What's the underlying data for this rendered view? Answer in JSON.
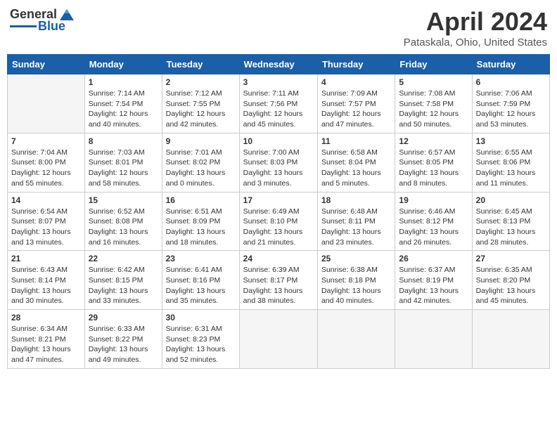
{
  "logo": {
    "general": "General",
    "blue": "Blue"
  },
  "title": "April 2024",
  "location": "Pataskala, Ohio, United States",
  "days_of_week": [
    "Sunday",
    "Monday",
    "Tuesday",
    "Wednesday",
    "Thursday",
    "Friday",
    "Saturday"
  ],
  "weeks": [
    [
      {
        "day": "",
        "info": ""
      },
      {
        "day": "1",
        "info": "Sunrise: 7:14 AM\nSunset: 7:54 PM\nDaylight: 12 hours\nand 40 minutes."
      },
      {
        "day": "2",
        "info": "Sunrise: 7:12 AM\nSunset: 7:55 PM\nDaylight: 12 hours\nand 42 minutes."
      },
      {
        "day": "3",
        "info": "Sunrise: 7:11 AM\nSunset: 7:56 PM\nDaylight: 12 hours\nand 45 minutes."
      },
      {
        "day": "4",
        "info": "Sunrise: 7:09 AM\nSunset: 7:57 PM\nDaylight: 12 hours\nand 47 minutes."
      },
      {
        "day": "5",
        "info": "Sunrise: 7:08 AM\nSunset: 7:58 PM\nDaylight: 12 hours\nand 50 minutes."
      },
      {
        "day": "6",
        "info": "Sunrise: 7:06 AM\nSunset: 7:59 PM\nDaylight: 12 hours\nand 53 minutes."
      }
    ],
    [
      {
        "day": "7",
        "info": "Sunrise: 7:04 AM\nSunset: 8:00 PM\nDaylight: 12 hours\nand 55 minutes."
      },
      {
        "day": "8",
        "info": "Sunrise: 7:03 AM\nSunset: 8:01 PM\nDaylight: 12 hours\nand 58 minutes."
      },
      {
        "day": "9",
        "info": "Sunrise: 7:01 AM\nSunset: 8:02 PM\nDaylight: 13 hours\nand 0 minutes."
      },
      {
        "day": "10",
        "info": "Sunrise: 7:00 AM\nSunset: 8:03 PM\nDaylight: 13 hours\nand 3 minutes."
      },
      {
        "day": "11",
        "info": "Sunrise: 6:58 AM\nSunset: 8:04 PM\nDaylight: 13 hours\nand 5 minutes."
      },
      {
        "day": "12",
        "info": "Sunrise: 6:57 AM\nSunset: 8:05 PM\nDaylight: 13 hours\nand 8 minutes."
      },
      {
        "day": "13",
        "info": "Sunrise: 6:55 AM\nSunset: 8:06 PM\nDaylight: 13 hours\nand 11 minutes."
      }
    ],
    [
      {
        "day": "14",
        "info": "Sunrise: 6:54 AM\nSunset: 8:07 PM\nDaylight: 13 hours\nand 13 minutes."
      },
      {
        "day": "15",
        "info": "Sunrise: 6:52 AM\nSunset: 8:08 PM\nDaylight: 13 hours\nand 16 minutes."
      },
      {
        "day": "16",
        "info": "Sunrise: 6:51 AM\nSunset: 8:09 PM\nDaylight: 13 hours\nand 18 minutes."
      },
      {
        "day": "17",
        "info": "Sunrise: 6:49 AM\nSunset: 8:10 PM\nDaylight: 13 hours\nand 21 minutes."
      },
      {
        "day": "18",
        "info": "Sunrise: 6:48 AM\nSunset: 8:11 PM\nDaylight: 13 hours\nand 23 minutes."
      },
      {
        "day": "19",
        "info": "Sunrise: 6:46 AM\nSunset: 8:12 PM\nDaylight: 13 hours\nand 26 minutes."
      },
      {
        "day": "20",
        "info": "Sunrise: 6:45 AM\nSunset: 8:13 PM\nDaylight: 13 hours\nand 28 minutes."
      }
    ],
    [
      {
        "day": "21",
        "info": "Sunrise: 6:43 AM\nSunset: 8:14 PM\nDaylight: 13 hours\nand 30 minutes."
      },
      {
        "day": "22",
        "info": "Sunrise: 6:42 AM\nSunset: 8:15 PM\nDaylight: 13 hours\nand 33 minutes."
      },
      {
        "day": "23",
        "info": "Sunrise: 6:41 AM\nSunset: 8:16 PM\nDaylight: 13 hours\nand 35 minutes."
      },
      {
        "day": "24",
        "info": "Sunrise: 6:39 AM\nSunset: 8:17 PM\nDaylight: 13 hours\nand 38 minutes."
      },
      {
        "day": "25",
        "info": "Sunrise: 6:38 AM\nSunset: 8:18 PM\nDaylight: 13 hours\nand 40 minutes."
      },
      {
        "day": "26",
        "info": "Sunrise: 6:37 AM\nSunset: 8:19 PM\nDaylight: 13 hours\nand 42 minutes."
      },
      {
        "day": "27",
        "info": "Sunrise: 6:35 AM\nSunset: 8:20 PM\nDaylight: 13 hours\nand 45 minutes."
      }
    ],
    [
      {
        "day": "28",
        "info": "Sunrise: 6:34 AM\nSunset: 8:21 PM\nDaylight: 13 hours\nand 47 minutes."
      },
      {
        "day": "29",
        "info": "Sunrise: 6:33 AM\nSunset: 8:22 PM\nDaylight: 13 hours\nand 49 minutes."
      },
      {
        "day": "30",
        "info": "Sunrise: 6:31 AM\nSunset: 8:23 PM\nDaylight: 13 hours\nand 52 minutes."
      },
      {
        "day": "",
        "info": ""
      },
      {
        "day": "",
        "info": ""
      },
      {
        "day": "",
        "info": ""
      },
      {
        "day": "",
        "info": ""
      }
    ]
  ]
}
